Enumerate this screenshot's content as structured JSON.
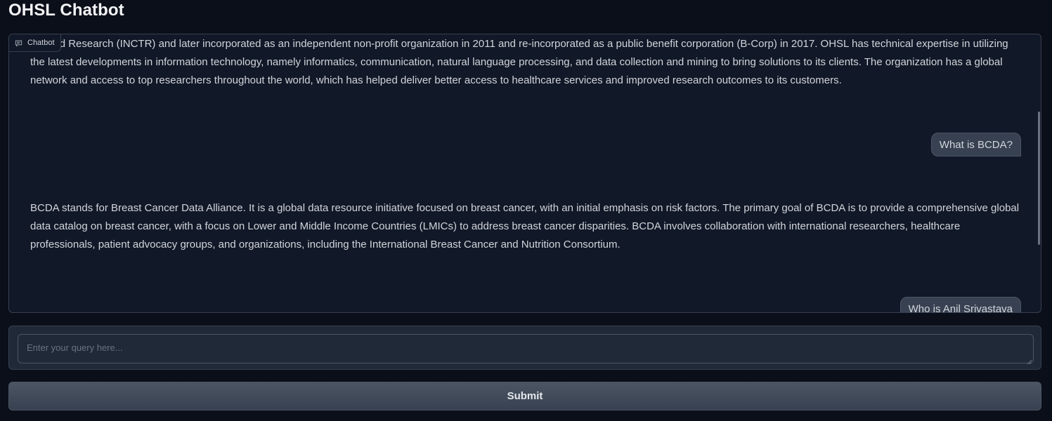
{
  "app": {
    "title": "OHSL Chatbot"
  },
  "chatbot": {
    "label": "Chatbot",
    "label_icon": "chat-bubble-icon",
    "messages": [
      {
        "role": "bot",
        "text": "ent and Research (INCTR) and later incorporated as an independent non-profit organization in 2011 and re-incorporated as a public benefit corporation (B-Corp) in 2017. OHSL has technical expertise in utilizing the latest developments in information technology, namely informatics, communication, natural language processing, and data collection and mining to bring solutions to its clients. The organization has a global network and access to top researchers throughout the world, which has helped deliver better access to healthcare services and improved research outcomes to its customers."
      },
      {
        "role": "user",
        "text": "What is BCDA?"
      },
      {
        "role": "bot",
        "text": "BCDA stands for Breast Cancer Data Alliance. It is a global data resource initiative focused on breast cancer, with an initial emphasis on risk factors. The primary goal of BCDA is to provide a comprehensive global data catalog on breast cancer, with a focus on Lower and Middle Income Countries (LMICs) to address breast cancer disparities. BCDA involves collaboration with international researchers, healthcare professionals, patient advocacy groups, and organizations, including the International Breast Cancer and Nutrition Consortium."
      },
      {
        "role": "user",
        "text": "Who is Anil Srivastava"
      }
    ]
  },
  "query": {
    "value": "",
    "placeholder": "Enter your query here..."
  },
  "submit": {
    "label": "Submit"
  },
  "colors": {
    "background": "#0b0f19",
    "panel": "#111827",
    "input_panel": "#1f2937",
    "border": "#374151",
    "user_bubble": "#374151",
    "text": "#d1d5db"
  }
}
